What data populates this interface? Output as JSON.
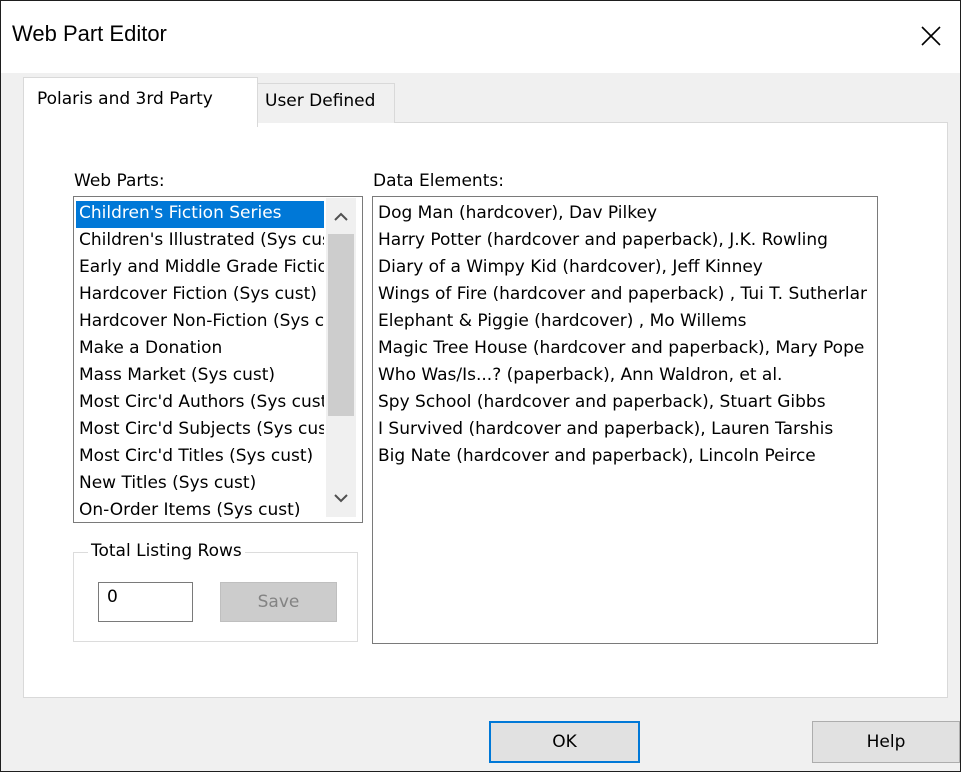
{
  "window": {
    "title": "Web Part Editor",
    "close_icon": "close-icon"
  },
  "tabs": [
    {
      "label": "Polaris and 3rd Party",
      "active": true
    },
    {
      "label": "User Defined",
      "active": false
    }
  ],
  "web_parts": {
    "label": "Web Parts:",
    "items": [
      "Children's Fiction Series",
      "Children's Illustrated  (Sys cust)",
      "Early and Middle Grade Fiction",
      "Hardcover Fiction  (Sys cust)",
      "Hardcover Non-Fiction (Sys cust)",
      "Make a Donation",
      "Mass Market (Sys cust)",
      "Most Circ'd Authors (Sys cust)",
      "Most Circ'd Subjects (Sys cust)",
      "Most Circ'd Titles (Sys cust)",
      "New Titles (Sys cust)",
      "On-Order Items (Sys cust)"
    ],
    "selected_index": 0,
    "scroll_up_icon": "chevron-up-icon",
    "scroll_down_icon": "chevron-down-icon"
  },
  "data_elements": {
    "label": "Data Elements:",
    "items": [
      "Dog Man (hardcover), Dav Pilkey",
      "Harry Potter (hardcover and paperback), J.K. Rowling",
      "Diary of a Wimpy Kid (hardcover), Jeff Kinney",
      "Wings of Fire (hardcover and paperback) , Tui T. Sutherland",
      "Elephant & Piggie (hardcover) , Mo Willems",
      "Magic Tree House (hardcover and paperback), Mary Pope Osborne",
      "Who Was/Is...? (paperback), Ann Waldron, et al.",
      "Spy School (hardcover and paperback), Stuart Gibbs",
      "I Survived (hardcover and paperback), Lauren Tarshis",
      "Big Nate (hardcover and paperback), Lincoln Peirce"
    ]
  },
  "total_listing_rows": {
    "legend": "Total Listing Rows",
    "value": "0",
    "save_label": "Save"
  },
  "footer": {
    "ok_label": "OK",
    "help_label": "Help"
  },
  "colors": {
    "selection": "#0078d7",
    "dialog_bg": "#f0f0f0",
    "panel_bg": "#ffffff"
  }
}
